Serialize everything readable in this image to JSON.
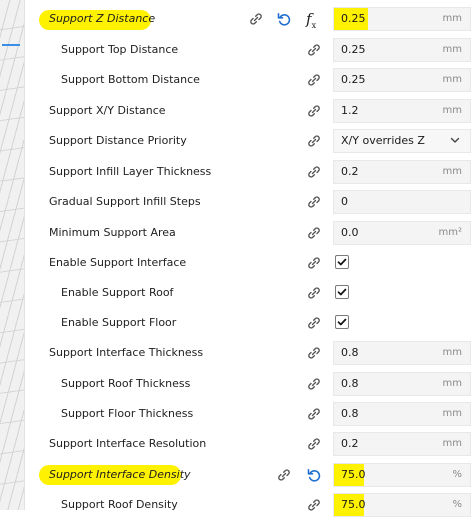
{
  "settings": [
    {
      "label": "Support Z Distance",
      "value": "0.25",
      "unit": "mm",
      "highlighted": true
    },
    {
      "label": "Support Top Distance",
      "value": "0.25",
      "unit": "mm"
    },
    {
      "label": "Support Bottom Distance",
      "value": "0.25",
      "unit": "mm"
    },
    {
      "label": "Support X/Y Distance",
      "value": "1.2",
      "unit": "mm"
    },
    {
      "label": "Support Distance Priority",
      "value": "X/Y overrides Z"
    },
    {
      "label": "Support Infill Layer Thickness",
      "value": "0.2",
      "unit": "mm"
    },
    {
      "label": "Gradual Support Infill Steps",
      "value": "0"
    },
    {
      "label": "Minimum Support Area",
      "value": "0.0",
      "unit": "mm²"
    },
    {
      "label": "Enable Support Interface",
      "checked": true
    },
    {
      "label": "Enable Support Roof",
      "checked": true
    },
    {
      "label": "Enable Support Floor",
      "checked": true
    },
    {
      "label": "Support Interface Thickness",
      "value": "0.8",
      "unit": "mm"
    },
    {
      "label": "Support Roof Thickness",
      "value": "0.8",
      "unit": "mm"
    },
    {
      "label": "Support Floor Thickness",
      "value": "0.8",
      "unit": "mm"
    },
    {
      "label": "Support Interface Resolution",
      "value": "0.2",
      "unit": "mm"
    },
    {
      "label": "Support Interface Density",
      "value": "75.0",
      "unit": "%",
      "highlighted": true
    },
    {
      "label": "Support Roof Density",
      "value": "75.0",
      "unit": "%"
    }
  ],
  "icons": {
    "link": "link-icon",
    "reset": "reset-icon",
    "function": "function-icon",
    "check": "check-icon",
    "dropdown": "chevron-down-icon"
  },
  "fx_symbol": "f",
  "fx_sub": "x",
  "colors": {
    "highlight": "#fff200",
    "reset_icon": "#1f6fd1",
    "field_bg": "#f4f4f4"
  }
}
